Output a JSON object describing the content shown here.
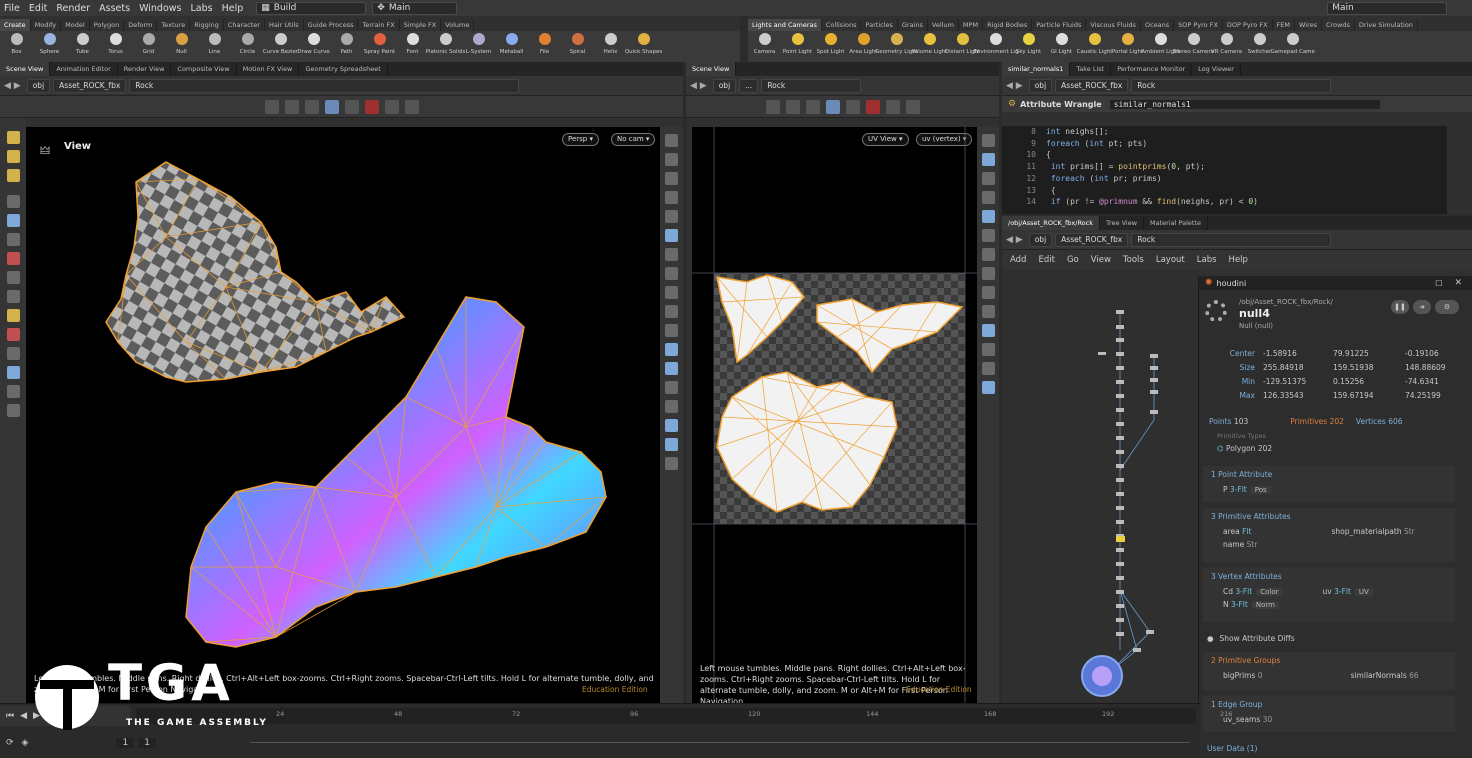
{
  "menu": [
    "File",
    "Edit",
    "Render",
    "Assets",
    "Windows",
    "Labs",
    "Help"
  ],
  "desktop_dd": "Build",
  "main_dd": "Main",
  "right_main_dd": "Main",
  "shelf_tabs_left": [
    "Create",
    "Modify",
    "Model",
    "Polygon",
    "Deform",
    "Texture",
    "Rigging",
    "Character",
    "Hair Utils",
    "Guide Process",
    "Terrain FX",
    "Simple FX",
    "Volume"
  ],
  "shelf_tabs_right": [
    "Lights and Cameras",
    "Collisions",
    "Particles",
    "Grains",
    "Vellum",
    "MPM",
    "Rigid Bodies",
    "Particle Fluids",
    "Viscous Fluids",
    "Oceans",
    "SOP Pyro FX",
    "DOP Pyro FX",
    "FEM",
    "Wires",
    "Crowds",
    "Drive Simulation"
  ],
  "shelf_tools_left": [
    "Box",
    "Sphere",
    "Tube",
    "Torus",
    "Grid",
    "Null",
    "Line",
    "Circle",
    "Curve Bezier",
    "Draw Curve",
    "Path",
    "Spray Paint",
    "Font",
    "Platonic Solids",
    "L-System",
    "Metaball",
    "File",
    "Spiral",
    "Helix",
    "Quick Shapes"
  ],
  "shelf_tools_right": [
    "Camera",
    "Point Light",
    "Spot Light",
    "Area Light",
    "Geometry Light",
    "Volume Light",
    "Distant Light",
    "Environment Light",
    "Sky Light",
    "GI Light",
    "Caustic Light",
    "Portal Light",
    "Ambient Light",
    "Stereo Camera",
    "VR Camera",
    "Switcher",
    "Gamepad Camera"
  ],
  "pane1_tabs": [
    "Scene View",
    "Animation Editor",
    "Render View",
    "Composite View",
    "Motion FX View",
    "Geometry Spreadsheet"
  ],
  "pane2_tabs": [
    "Scene View"
  ],
  "pane3_tabs": [
    "similar_normals1",
    "Take List",
    "Performance Monitor",
    "Log Viewer"
  ],
  "pane4_tabs": [
    "/obj/Asset_ROCK_fbx/Rock",
    "Tree View",
    "Material Palette"
  ],
  "path": {
    "obj": "obj",
    "asset": "Asset_ROCK_fbx",
    "rock": "Rock",
    "ellipsis": "..."
  },
  "viewport": {
    "label": "View",
    "persp": "Persp ▾",
    "nocam": "No cam ▾",
    "uvview": "UV View ▾",
    "uvvertex": "uv (vertex) ▾"
  },
  "hint_left": "Left mouse tumbles. Middle pans. Right dollies. Ctrl+Alt+Left box-zooms. Ctrl+Right zooms. Spacebar-Ctrl-Left tilts. Hold L for alternate tumble, dolly, and zoom. M or Alt+M for First Person Navigation.",
  "hint_mid": "Left mouse tumbles. Middle pans. Right dollies. Ctrl+Alt+Left box-zooms. Ctrl+Right zooms. Spacebar-Ctrl-Left tilts. Hold L for alternate tumble, dolly, and zoom. M or Alt+M for First Person Navigation.",
  "edu": "Education Edition",
  "wrangle": {
    "title": "Attribute Wrangle",
    "name": "similar_normals1"
  },
  "code_lines": [
    {
      "n": "8",
      "t": "int neighs[];"
    },
    {
      "n": "9",
      "t": "foreach (int pt; pts)"
    },
    {
      "n": "10",
      "t": "{"
    },
    {
      "n": "11",
      "t": "    int prims[] = pointprims(0, pt);"
    },
    {
      "n": "12",
      "t": "    foreach (int pr; prims)"
    },
    {
      "n": "13",
      "t": "    {"
    },
    {
      "n": "14",
      "t": "        if (pr != @primnum && find(neighs, pr) < 0)"
    }
  ],
  "net_menu": [
    "Add",
    "Edit",
    "Go",
    "View",
    "Tools",
    "Layout",
    "Labs",
    "Help"
  ],
  "info": {
    "app": "houdini",
    "path": "/obj/Asset_ROCK_fbx/Rock/",
    "node": "null4",
    "type": "Null",
    "type2": "(null)",
    "center_label": "Center",
    "center": [
      "-1.58916",
      "79.91225",
      "-0.19106"
    ],
    "size_label": "Size",
    "size": [
      "255.84918",
      "159.51938",
      "148.88609"
    ],
    "min_label": "Min",
    "min": [
      "-129.51375",
      "0.15256",
      "-74.6341"
    ],
    "max_label": "Max",
    "max": [
      "126.33543",
      "159.67194",
      "74.25199"
    ],
    "points_label": "Points",
    "points": "103",
    "prims_label": "Primitives",
    "prims": "202",
    "verts_label": "Vertices",
    "verts": "606",
    "prim_types": "Primitive Types",
    "polygon": "Polygon",
    "polygon_n": "202",
    "pt_attr": "1 Point Attribute",
    "P": "P",
    "P_type": "3-Flt",
    "P_pill": "Pos",
    "prim_attr": "3 Primitive Attributes",
    "area": "area",
    "area_t": "Flt",
    "shop": "shop_materialpath",
    "shop_t": "Str",
    "name": "name",
    "name_t": "Str",
    "vtx_attr": "3 Vertex Attributes",
    "Cd": "Cd",
    "Cd_t": "3-Flt",
    "Cd_pill": "Color",
    "uv": "uv",
    "uv_t": "3-Flt",
    "uv_pill": "UV",
    "N": "N",
    "N_t": "3-Flt",
    "N_pill": "Norm",
    "show_diffs": "Show Attribute Diffs",
    "prim_groups": "2 Primitive Groups",
    "bigPrims": "bigPrims",
    "bigPrims_n": "0",
    "similar": "similarNormals",
    "similar_n": "66",
    "edge_group": "1 Edge Group",
    "uv_seams": "uv_seams",
    "uv_seams_n": "30",
    "user_data": "User Data (1)"
  },
  "timeline": {
    "ticks": [
      "24",
      "48",
      "72",
      "96",
      "120",
      "144",
      "168",
      "192",
      "216"
    ],
    "frame": "1",
    "start": "1",
    "end": "1"
  },
  "logo": {
    "big": "TGA",
    "small": "THE GAME ASSEMBLY"
  },
  "colors": {
    "accent": "#e8a33a",
    "wire": "#f0a030",
    "bg": "#2b2b2b"
  }
}
